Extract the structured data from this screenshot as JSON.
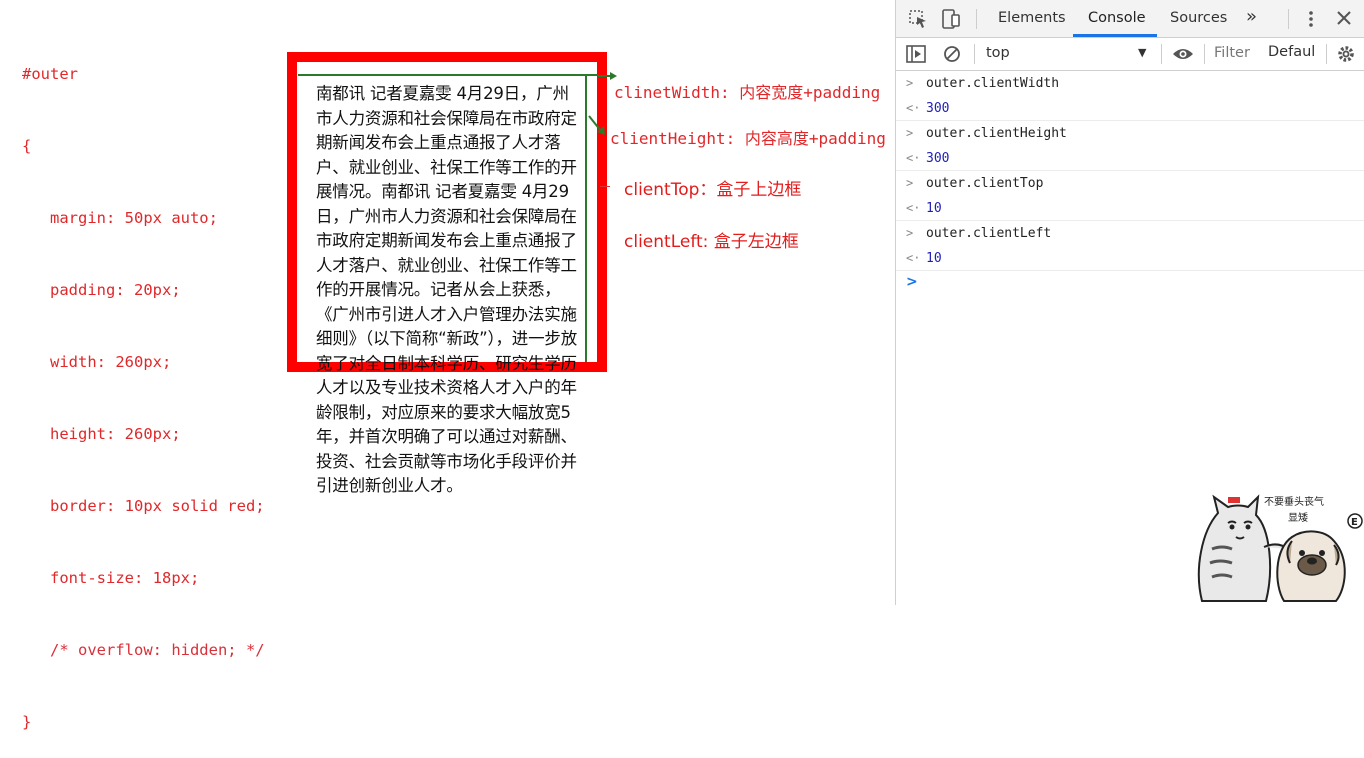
{
  "code": {
    "selector": "#outer",
    "open": "{",
    "lines": [
      "margin: 50px auto;",
      "padding: 20px;",
      "width: 260px;",
      "height: 260px;",
      "border: 10px solid red;",
      "font-size: 18px;"
    ],
    "comment": "/* overflow: hidden; */",
    "close": "}"
  },
  "article": "南都讯 记者夏嘉雯 4月29日，广州市人力资源和社会保障局在市政府定期新闻发布会上重点通报了人才落户、就业创业、社保工作等工作的开展情况。南都讯 记者夏嘉雯 4月29日，广州市人力资源和社会保障局在市政府定期新闻发布会上重点通报了人才落户、就业创业、社保工作等工作的开展情况。记者从会上获悉，《广州市引进人才入户管理办法实施细则》（以下简称“新政”），进一步放宽了对全日制本科学历、研究生学历人才以及专业技术资格人才入户的年龄限制，对应原来的要求大幅放宽5年，并首次明确了可以通过对薪酬、投资、社会贡献等市场化手段评价并引进创新创业人才。",
  "notes": {
    "client_width": "clinetWidth: 内容宽度+padding",
    "client_height": "clientHeight: 内容高度+padding",
    "client_top": "clientTop：盒子上边框",
    "client_left": "clientLeft: 盒子左边框"
  },
  "devtools": {
    "tabs": [
      "Elements",
      "Console",
      "Sources"
    ],
    "active_tab": "Console",
    "more": "»",
    "context": "top",
    "filter_placeholder": "Filter",
    "levels": "Defaul",
    "console": [
      {
        "input": "outer.clientWidth",
        "output": "300"
      },
      {
        "input": "outer.clientHeight",
        "output": "300"
      },
      {
        "input": "outer.clientTop",
        "output": "10"
      },
      {
        "input": "outer.clientLeft",
        "output": "10"
      }
    ]
  },
  "sticker": {
    "caption_1": "不要垂头丧气",
    "caption_2": "显矮"
  },
  "colors": {
    "code_red": "#e0282b",
    "border_red": "#ff0000",
    "guide_green": "#2b7a2b",
    "devtools_blue": "#1a73e8"
  }
}
